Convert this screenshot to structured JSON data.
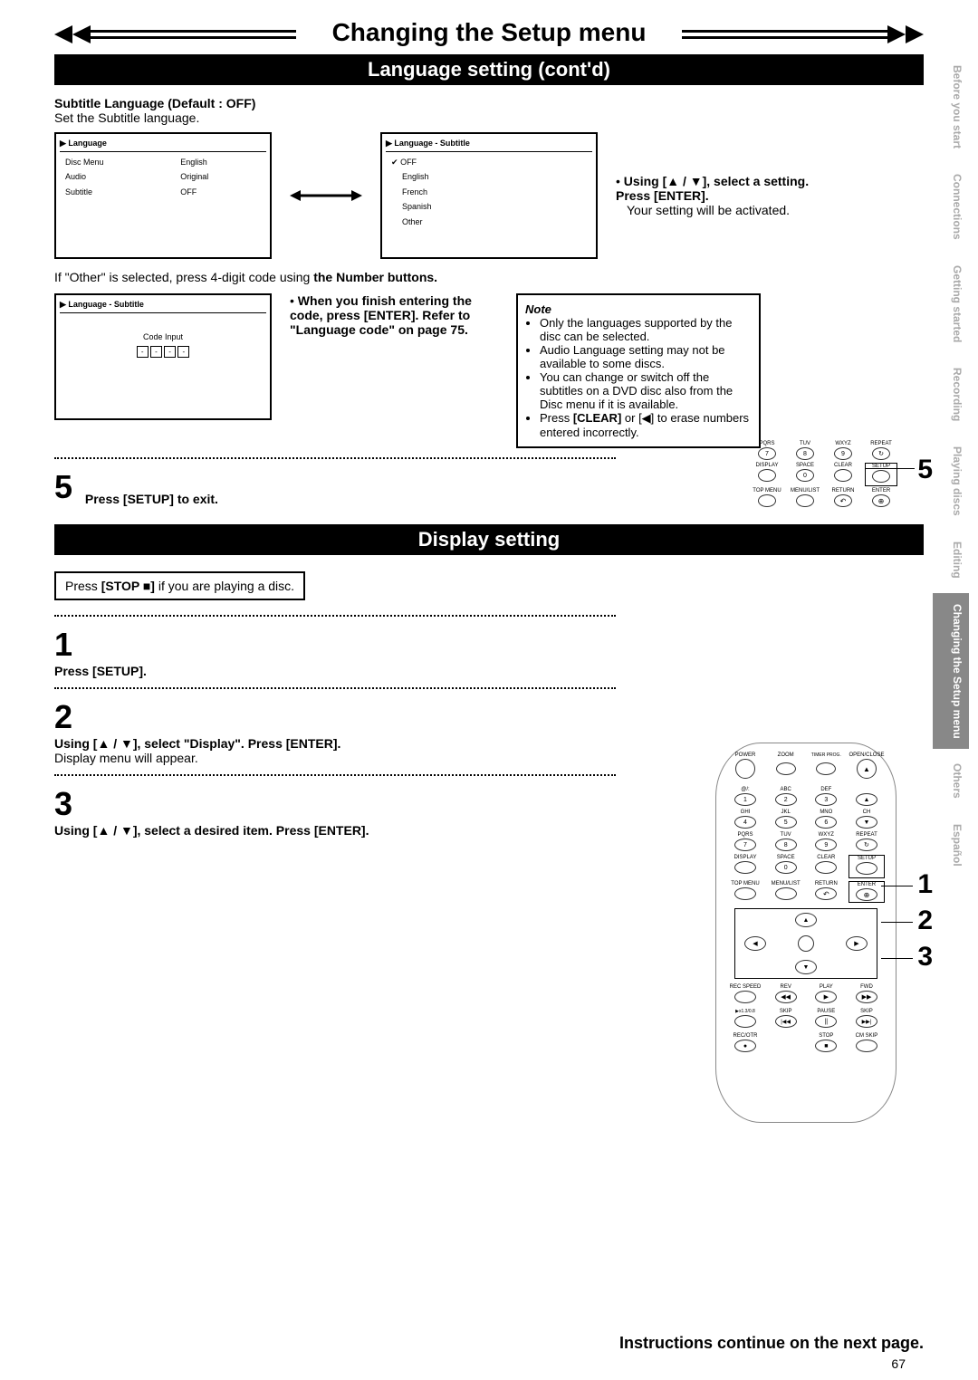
{
  "title": "Changing the Setup menu",
  "banner1": "Language setting (cont'd)",
  "banner2": "Display setting",
  "subtitle_lang": {
    "heading": "Subtitle Language (Default : OFF)",
    "desc": "Set the Subtitle language."
  },
  "menu1": {
    "title": "Language",
    "rows": [
      [
        "Disc Menu",
        "English"
      ],
      [
        "Audio",
        "Original"
      ],
      [
        "Subtitle",
        "OFF"
      ]
    ]
  },
  "menu2": {
    "title": "Language - Subtitle",
    "items": [
      "OFF",
      "English",
      "French",
      "Spanish",
      "Other"
    ]
  },
  "menu3": {
    "title": "Language - Subtitle",
    "code": "Code Input"
  },
  "instr_select": {
    "bold": "Using [▲ / ▼], select a setting. Press [ENTER].",
    "text": "Your setting will be activated."
  },
  "instr_other": "If \"Other\" is selected, press 4-digit code using the Number buttons.",
  "instr_code": "When you finish entering the code, press [ENTER]. Refer to \"Language code\" on page 75.",
  "note": {
    "hdr": "Note",
    "items": [
      "Only the languages supported by the disc can be selected.",
      "Audio Language setting may not be available to some discs.",
      "You can change or switch off the subtitles on a DVD disc also from the Disc menu if it is available.",
      "Press [CLEAR] or [◀] to erase numbers entered incorrectly."
    ]
  },
  "step5": "Press [SETUP] to exit.",
  "press_stop": "Press [STOP ■] if you are playing a disc.",
  "ds1": "Press [SETUP].",
  "ds2b": "Using [▲ / ▼], select \"Display\". Press [ENTER].",
  "ds2t": "Display menu will appear.",
  "ds3": "Using [▲ / ▼], select a desired item. Press [ENTER].",
  "footer": {
    "cont": "Instructions continue on the next page.",
    "page": "67"
  },
  "tabs": [
    "Before you start",
    "Connections",
    "Getting started",
    "Recording",
    "Playing discs",
    "Editing",
    "Changing the Setup menu",
    "Others",
    "Español"
  ],
  "remote_labels": {
    "r1": [
      "PQRS",
      "TUV",
      "WXYZ",
      "REPEAT"
    ],
    "b1": [
      "7",
      "8",
      "9",
      "↻"
    ],
    "r2": [
      "DISPLAY",
      "SPACE",
      "CLEAR",
      "SETUP"
    ],
    "b2": [
      "0"
    ],
    "r3": [
      "TOP MENU",
      "MENU/LIST",
      "RETURN",
      "ENTER"
    ]
  },
  "remote2_labels": {
    "top": [
      "POWER",
      "ZOOM",
      "TIMER PROG.",
      "OPEN/CLOSE"
    ],
    "row_a": [
      "@/:",
      "ABC",
      "DEF",
      ""
    ],
    "btn_a": [
      "1",
      "2",
      "3",
      "▲"
    ],
    "row_b": [
      "GHI",
      "JKL",
      "MNO",
      "CH"
    ],
    "btn_b": [
      "4",
      "5",
      "6",
      "▼"
    ],
    "row_c": [
      "PQRS",
      "TUV",
      "WXYZ",
      "REPEAT"
    ],
    "btn_c": [
      "7",
      "8",
      "9",
      "↻"
    ],
    "row_d": [
      "DISPLAY",
      "SPACE",
      "CLEAR",
      "SETUP"
    ],
    "btn_d": [
      "0"
    ],
    "row_e": [
      "TOP MENU",
      "MENU/LIST",
      "RETURN",
      "ENTER"
    ],
    "dir": [
      "▲",
      "◀",
      "▶",
      "▼"
    ],
    "row_f": [
      "REC SPEED",
      "REV",
      "PLAY",
      "FWD"
    ],
    "btn_f": [
      "",
      "◀◀",
      "▶",
      "▶▶"
    ],
    "row_g": [
      "▶x1.3/0.8",
      "SKIP",
      "PAUSE",
      "SKIP"
    ],
    "btn_g": [
      "",
      "|◀◀",
      "||",
      "▶▶|"
    ],
    "row_h": [
      "REC/OTR",
      "",
      "STOP",
      "CM SKIP"
    ],
    "btn_h": [
      "●",
      "",
      "■",
      ""
    ]
  },
  "callouts": {
    "c5": "5",
    "c1": "1",
    "c2": "2",
    "c3": "3"
  }
}
